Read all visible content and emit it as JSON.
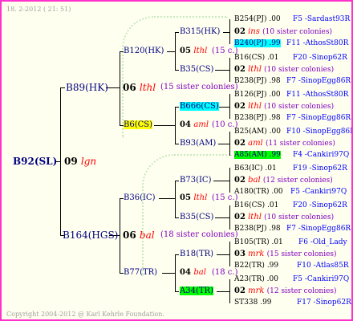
{
  "header": {
    "date": "18. 2-2012 ( 21: 51)"
  },
  "footer": {
    "copyright": "Copyright 2004-2012 @ Karl Kehrle Foundation."
  },
  "root": {
    "id": "B92(SL)",
    "gen": "09",
    "line": "lgn"
  },
  "gen1": [
    {
      "id": "B89(HK)",
      "gen": "06",
      "line": "lthl",
      "note": "(15 sister colonies)"
    },
    {
      "id": "B164(HGS)",
      "gen": "06",
      "line": "bal",
      "note": "(18 sister colonies)"
    }
  ],
  "gen2": [
    {
      "id": "B120(HK)",
      "gen": "05",
      "line": "lthl",
      "note": "(15 c.)"
    },
    {
      "id": "B6(CS)",
      "gen": "04",
      "line": "aml",
      "note": "(10 c.)"
    },
    {
      "id": "B36(IC)",
      "gen": "05",
      "line": "lthl",
      "note": "(15 c.)"
    },
    {
      "id": "B77(TR)",
      "gen": "04",
      "line": "bal",
      "note": "(18 c.)"
    }
  ],
  "gen3": [
    {
      "id": "B315(HK)"
    },
    {
      "id": "B35(CS)"
    },
    {
      "id": "B666(CS)"
    },
    {
      "id": "B93(AM)"
    },
    {
      "id": "B73(IC)"
    },
    {
      "id": "B35(CS)"
    },
    {
      "id": "B18(TR)"
    },
    {
      "id": "A34(TR)"
    }
  ],
  "gen4": [
    {
      "sire": "B254(PJ) .00",
      "sire_tag": "F5 -Sardast93R",
      "gen": "02",
      "line": "ins",
      "note": "(10 sister colonies)",
      "dam": "B240(PJ) .99",
      "dam_tag": "F11 -AthosSt80R"
    },
    {
      "sire": "B16(CS) .01",
      "sire_tag": "F20 -Sinop62R",
      "gen": "02",
      "line": "lthl",
      "note": "(10 sister colonies)",
      "dam": "B238(PJ) .98",
      "dam_tag": "F7 -SinopEgg86R"
    },
    {
      "sire": "B126(PJ) .00",
      "sire_tag": "F11 -AthosSt80R",
      "gen": "02",
      "line": "lthl",
      "note": "(10 sister colonies)",
      "dam": "B238(PJ) .98",
      "dam_tag": "F7 -SinopEgg86R"
    },
    {
      "sire": "B25(AM) .00",
      "sire_tag": "F10 -SinopEgg86R",
      "gen": "02",
      "line": "aml",
      "note": "(11 sister colonies)",
      "dam": "A85(AM) .99",
      "dam_tag": "F4 -Cankiri97Q"
    },
    {
      "sire": "B63(IC) .01",
      "sire_tag": "F19 -Sinop62R",
      "gen": "02",
      "line": "bal",
      "note": "(12 sister colonies)",
      "dam": "A180(TR) .00",
      "dam_tag": "F5 -Cankiri97Q"
    },
    {
      "sire": "B16(CS) .01",
      "sire_tag": "F20 -Sinop62R",
      "gen": "02",
      "line": "lthl",
      "note": "(10 sister colonies)",
      "dam": "B238(PJ) .98",
      "dam_tag": "F7 -SinopEgg86R"
    },
    {
      "sire": "B105(TR) .01",
      "sire_tag": "F6 -Old_Lady",
      "gen": "03",
      "line": "mrk",
      "note": "(15 sister colonies)",
      "dam": "B22(TR) .99",
      "dam_tag": "F10 -Atlas85R"
    },
    {
      "sire": "A23(TR) .00",
      "sire_tag": "F5 -Cankiri97Q",
      "gen": "02",
      "line": "mrk",
      "note": "(12 sister colonies)",
      "dam": "ST338 .99",
      "dam_tag": "F17 -Sinop62R"
    }
  ]
}
